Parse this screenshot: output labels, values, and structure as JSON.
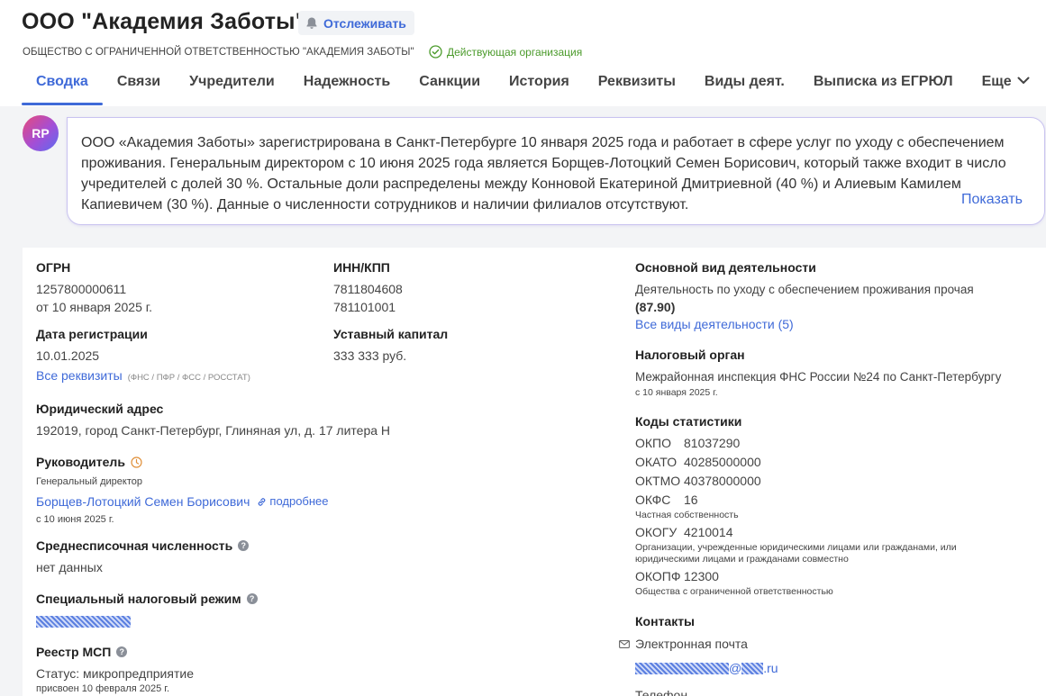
{
  "header": {
    "title": "ООО \"Академия Заботы\"",
    "track_label": "Отслеживать",
    "full_name": "ОБЩЕСТВО С ОГРАНИЧЕННОЙ ОТВЕТСТВЕННОСТЬЮ \"АКАДЕМИЯ ЗАБОТЫ\"",
    "status": "Действующая организация"
  },
  "tabs": [
    {
      "label": "Сводка"
    },
    {
      "label": "Связи"
    },
    {
      "label": "Учредители"
    },
    {
      "label": "Надежность"
    },
    {
      "label": "Санкции"
    },
    {
      "label": "История"
    },
    {
      "label": "Реквизиты"
    },
    {
      "label": "Виды деят."
    },
    {
      "label": "Выписка из ЕГРЮЛ"
    },
    {
      "label": "Еще"
    }
  ],
  "summary": {
    "avatar": "RP",
    "text": "ООО «Академия Заботы» зарегистрирована в Санкт-Петербурге 10 января 2025 года и работает в сфере услуг по уходу с обеспечением проживания. Генеральным директором с 10 июня 2025 года является Борщев-Лотоцкий Семен Борисович, который также входит в число учредителей с долей 30 %. Остальные доли распределены между Конновой Екатериной Дмитриевной (40 %) и Алиевым Камилем Капиевичем (30 %). Данные о численности сотрудников и наличии филиалов отсутствуют.",
    "show_label": "Показать"
  },
  "info": {
    "ogrn": {
      "label": "ОГРН",
      "value": "1257800000611",
      "date": "от 10 января 2025 г."
    },
    "inn": {
      "label": "ИНН/КПП",
      "inn": "7811804608",
      "kpp": "781101001"
    },
    "reg": {
      "label": "Дата регистрации",
      "value": "10.01.2025",
      "link": "Все реквизиты",
      "link_note": "(ФНС / ПФР / ФСС / РОССТАТ)"
    },
    "capital": {
      "label": "Уставный капитал",
      "value": "333 333 руб."
    },
    "address": {
      "label": "Юридический адрес",
      "value": "192019, город Санкт-Петербург, Глиняная ул, д. 17 литера Н"
    },
    "head": {
      "label": "Руководитель",
      "position": "Генеральный директор",
      "name": "Борщев-Лотоцкий Семен Борисович",
      "more": "подробнее",
      "since": "с 10 июня 2025 г."
    },
    "employees": {
      "label": "Среднесписочная численность",
      "value": "нет данных"
    },
    "tax_regime": {
      "label": "Специальный налоговый режим"
    },
    "msp": {
      "label": "Реестр МСП",
      "status": "Статус: микропредприятие",
      "assigned": "присвоен 10 февраля 2025 г."
    },
    "activity": {
      "label": "Основной вид деятельности",
      "value": "Деятельность по уходу с обеспечением проживания прочая",
      "code": "(87.90)",
      "link": "Все виды деятельности (5)"
    },
    "tax_office": {
      "label": "Налоговый орган",
      "value": "Межрайонная инспекция ФНС России №24 по Санкт-Петербургу",
      "date": "с 10 января 2025 г."
    },
    "stats": {
      "label": "Коды статистики",
      "okpo": {
        "k": "ОКПО",
        "v": "81037290"
      },
      "okato": {
        "k": "ОКАТО",
        "v": "40285000000"
      },
      "oktmo": {
        "k": "ОКТМО",
        "v": "40378000000"
      },
      "okfs": {
        "k": "ОКФС",
        "v": "16",
        "note": "Частная собственность"
      },
      "okogu": {
        "k": "ОКОГУ",
        "v": "4210014",
        "note": "Организации, учрежденные юридическими лицами или гражданами, или юридическими лицами и гражданами совместно"
      },
      "okopf": {
        "k": "ОКОПФ",
        "v": "12300",
        "note": "Общества с ограниченной ответственностью"
      }
    },
    "contacts": {
      "label": "Контакты",
      "email_label": "Электронная почта",
      "email_at": "@",
      "email_tld": ".ru",
      "phone_label": "Телефон"
    }
  },
  "colors": {
    "accent": "#3f6ad8",
    "status_green": "#4a9a2a",
    "mask_blue": "#5b7fe0"
  }
}
